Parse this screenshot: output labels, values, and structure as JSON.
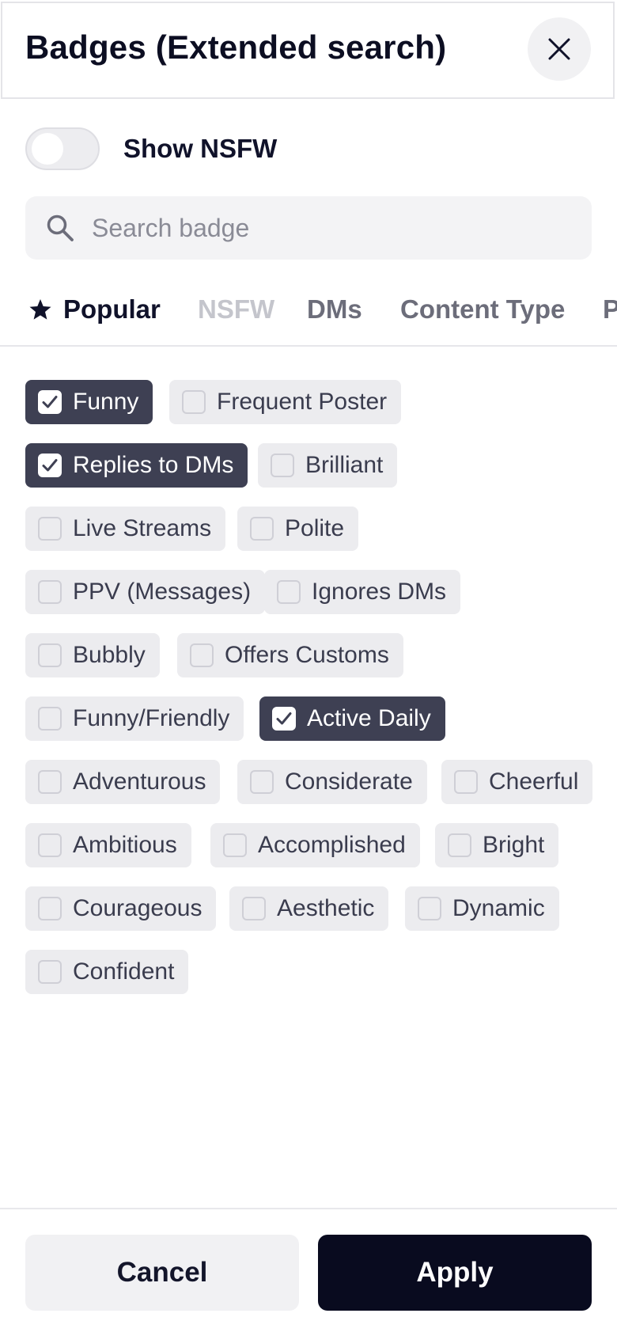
{
  "header": {
    "title": "Badges (Extended search)",
    "close_icon": "close-icon"
  },
  "nsfw_toggle": {
    "label": "Show NSFW",
    "on": false
  },
  "search": {
    "placeholder": "Search badge",
    "value": "",
    "icon": "search-icon"
  },
  "tabs": [
    {
      "label": "Popular",
      "icon": "star-icon",
      "state": "active"
    },
    {
      "label": "NSFW",
      "state": "disabled"
    },
    {
      "label": "DMs",
      "state": "inactive"
    },
    {
      "label": "Content Type",
      "state": "inactive"
    },
    {
      "label": "P",
      "state": "inactive"
    }
  ],
  "badges": [
    {
      "label": "Funny",
      "checked": true
    },
    {
      "label": "Frequent Poster",
      "checked": false
    },
    {
      "label": "Replies to DMs",
      "checked": true
    },
    {
      "label": "Brilliant",
      "checked": false
    },
    {
      "label": "Live Streams",
      "checked": false
    },
    {
      "label": "Polite",
      "checked": false
    },
    {
      "label": "PPV (Messages)",
      "checked": false
    },
    {
      "label": "Ignores DMs",
      "checked": false
    },
    {
      "label": "Bubbly",
      "checked": false
    },
    {
      "label": "Offers Customs",
      "checked": false
    },
    {
      "label": "Funny/Friendly",
      "checked": false
    },
    {
      "label": "Active Daily",
      "checked": true
    },
    {
      "label": "Adventurous",
      "checked": false
    },
    {
      "label": "Considerate",
      "checked": false
    },
    {
      "label": "Cheerful",
      "checked": false
    },
    {
      "label": "Ambitious",
      "checked": false
    },
    {
      "label": "Accomplished",
      "checked": false
    },
    {
      "label": "Bright",
      "checked": false
    },
    {
      "label": "Courageous",
      "checked": false
    },
    {
      "label": "Aesthetic",
      "checked": false
    },
    {
      "label": "Dynamic",
      "checked": false
    },
    {
      "label": "Confident",
      "checked": false
    }
  ],
  "footer": {
    "cancel_label": "Cancel",
    "apply_label": "Apply"
  },
  "colors": {
    "checked_chip": "#3e4053",
    "unchecked_chip": "#ececef",
    "apply_button": "#090b1f"
  }
}
